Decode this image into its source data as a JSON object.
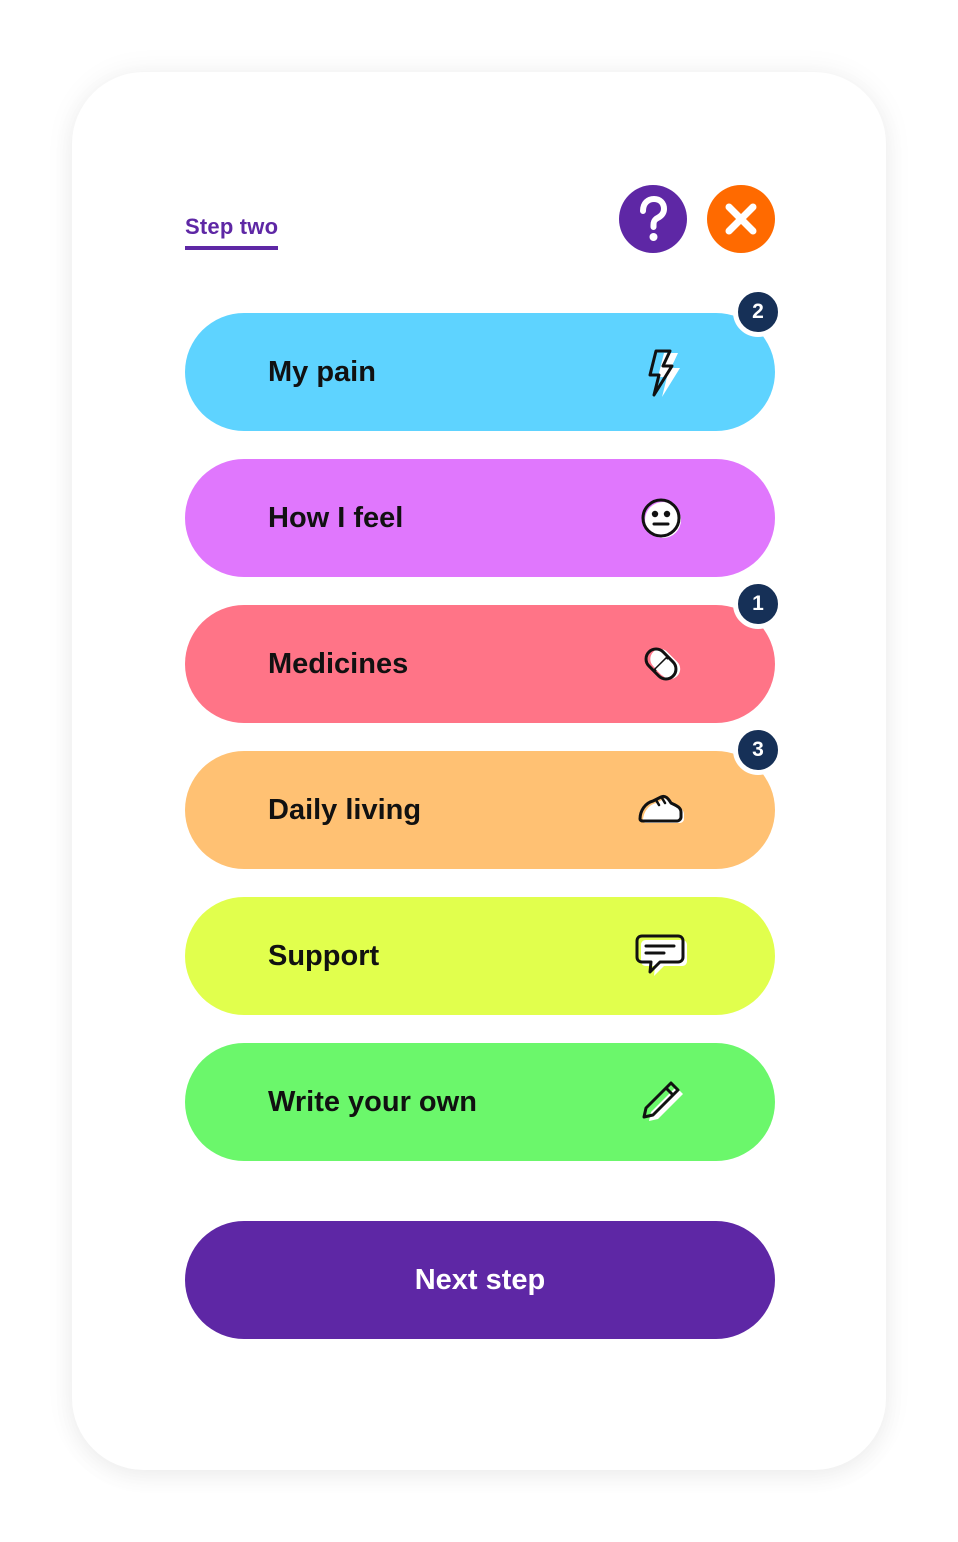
{
  "header": {
    "step_label": "Step two",
    "help_icon": "question-icon",
    "close_icon": "close-icon"
  },
  "categories": [
    {
      "label": "My pain",
      "icon": "lightning-icon",
      "color": "#5ed3ff",
      "badge": "2"
    },
    {
      "label": "How I feel",
      "icon": "neutral-face-icon",
      "color": "#e077fd",
      "badge": ""
    },
    {
      "label": "Medicines",
      "icon": "pill-icon",
      "color": "#ff7487",
      "badge": "1"
    },
    {
      "label": "Daily living",
      "icon": "shoe-icon",
      "color": "#ffc173",
      "badge": "3"
    },
    {
      "label": "Support",
      "icon": "chat-bubble-icon",
      "color": "#e1ff4d",
      "badge": ""
    },
    {
      "label": "Write your own",
      "icon": "pencil-icon",
      "color": "#6bf76b",
      "badge": ""
    }
  ],
  "footer": {
    "next_label": "Next step"
  },
  "colors": {
    "primary": "#5e27a5",
    "close": "#ff6a00",
    "badge": "#163057"
  }
}
